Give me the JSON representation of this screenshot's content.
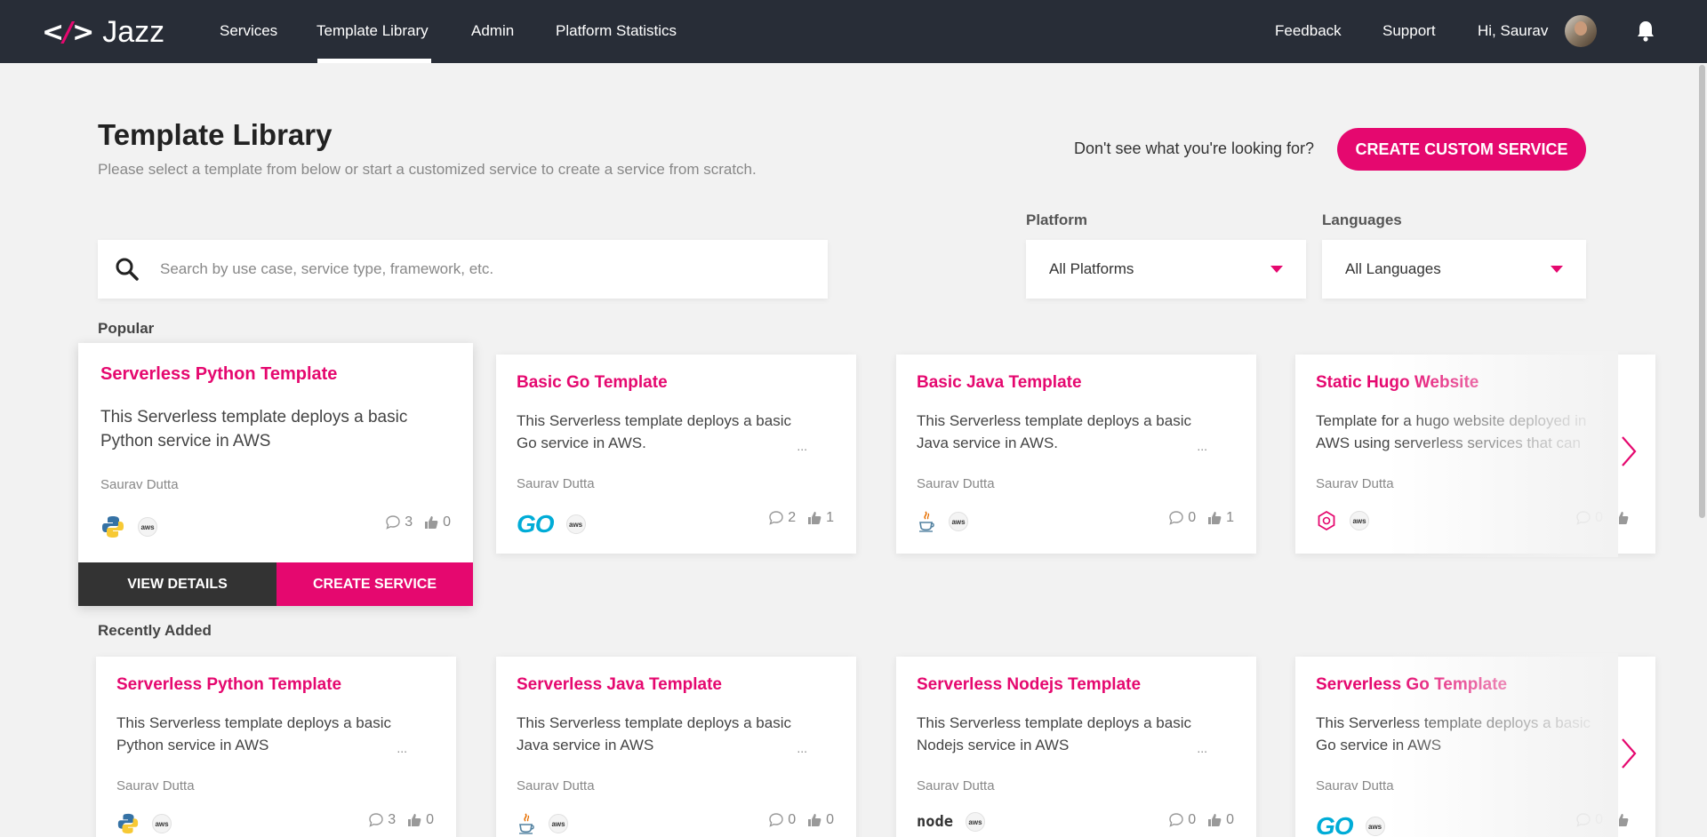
{
  "nav": {
    "logo_text": "Jazz",
    "links": [
      "Services",
      "Template Library",
      "Admin",
      "Platform Statistics"
    ],
    "right_links": [
      "Feedback",
      "Support"
    ],
    "greeting": "Hi, Saurav"
  },
  "header": {
    "title": "Template Library",
    "subtitle": "Please select a template from below or start a customized service to create a service from scratch.",
    "cta_text": "Don't see what you're looking for?",
    "cta_button": "CREATE CUSTOM SERVICE"
  },
  "search": {
    "placeholder": "Search by use case, service type, framework, etc."
  },
  "filters": {
    "platform_label": "Platform",
    "platform_value": "All Platforms",
    "languages_label": "Languages",
    "languages_value": "All Languages"
  },
  "popular": {
    "label": "Popular",
    "featured": {
      "title": "Serverless Python Template",
      "description": "This Serverless template deploys a basic Python service in AWS",
      "author": "Saurav Dutta",
      "comments": "3",
      "likes": "0",
      "view_label": "VIEW DETAILS",
      "create_label": "CREATE SERVICE"
    },
    "cards": [
      {
        "title": "Basic Go Template",
        "description": "This Serverless template deploys a basic Go service in AWS.",
        "author": "Saurav Dutta",
        "comments": "2",
        "likes": "1"
      },
      {
        "title": "Basic Java Template",
        "description": "This Serverless template deploys a basic Java service in AWS.",
        "author": "Saurav Dutta",
        "comments": "0",
        "likes": "1"
      },
      {
        "title": "Static Hugo Website",
        "description": "Template for a hugo website deployed in AWS using serverless services that can",
        "author": "Saurav Dutta",
        "comments": "0",
        "likes": ""
      }
    ]
  },
  "recent": {
    "label": "Recently Added",
    "cards": [
      {
        "title": "Serverless Python Template",
        "description": "This Serverless template deploys a basic Python service in AWS",
        "author": "Saurav Dutta",
        "comments": "3",
        "likes": "0"
      },
      {
        "title": "Serverless Java Template",
        "description": "This Serverless template deploys a basic Java service in AWS",
        "author": "Saurav Dutta",
        "comments": "0",
        "likes": "0"
      },
      {
        "title": "Serverless Nodejs Template",
        "description": "This Serverless template deploys a basic Nodejs service in AWS",
        "author": "Saurav Dutta",
        "comments": "0",
        "likes": "0"
      },
      {
        "title": "Serverless Go Template",
        "description": "This Serverless template deploys a basic Go service in AWS",
        "author": "Saurav Dutta",
        "comments": "0",
        "likes": ""
      }
    ]
  },
  "icons": {
    "aws_text": "aws",
    "go_text": "GO",
    "node_text": "node",
    "ellipsis": "..."
  },
  "colors": {
    "accent": "#e5086f",
    "nav_bg": "#282d37",
    "page_bg": "#f2f2f2"
  }
}
